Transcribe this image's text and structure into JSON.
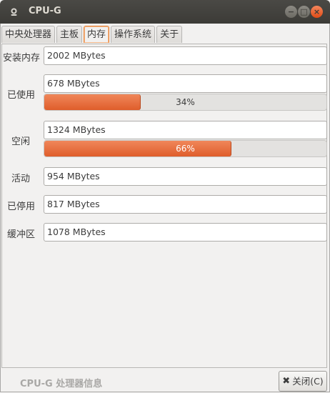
{
  "window": {
    "title": "CPU-G",
    "buttons": {
      "minimize": "−",
      "maximize": "□",
      "close": "×"
    }
  },
  "tabs": [
    {
      "label": "中央处理器",
      "active": false
    },
    {
      "label": "主板",
      "active": false
    },
    {
      "label": "内存",
      "active": true
    },
    {
      "label": "操作系统",
      "active": false
    },
    {
      "label": "关于",
      "active": false
    }
  ],
  "memory": {
    "installed": {
      "label": "安装内存",
      "value": "2002 MBytes"
    },
    "used": {
      "label": "已使用",
      "value": "678 MBytes",
      "percent_text": "34%",
      "fraction": 0.34
    },
    "free": {
      "label": "空闲",
      "value": "1324 MBytes",
      "percent_text": "66%",
      "fraction": 0.66
    },
    "active": {
      "label": "活动",
      "value": "954 MBytes"
    },
    "inactive": {
      "label": "已停用",
      "value": "817 MBytes"
    },
    "buffers": {
      "label": "缓冲区",
      "value": "1078 MBytes"
    }
  },
  "footer": {
    "app_caption": "CPU-G 处理器信息",
    "close_button": "关闭(C)",
    "close_icon": "✖"
  },
  "colors": {
    "accent": "#e8652f",
    "titlebar": "#3c3b37",
    "window_close": "#df4b16"
  }
}
